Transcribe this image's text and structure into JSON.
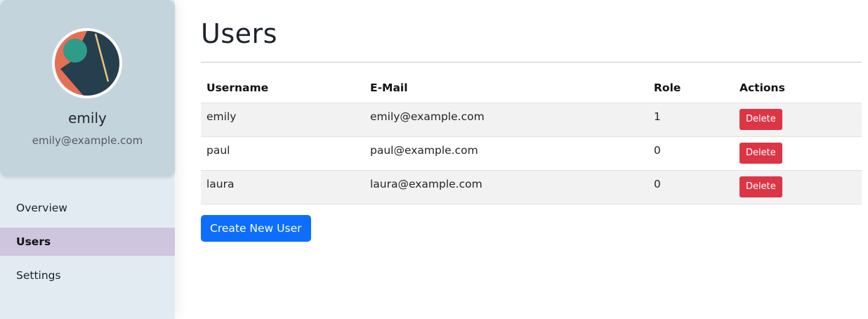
{
  "sidebar": {
    "profile": {
      "name": "emily",
      "email": "emily@example.com",
      "avatar_icon": "abstract-avatar-icon"
    },
    "items": [
      {
        "label": "Overview",
        "active": false
      },
      {
        "label": "Users",
        "active": true
      },
      {
        "label": "Settings",
        "active": false
      }
    ],
    "active_color": "#cfc5de"
  },
  "main": {
    "title": "Users",
    "table": {
      "columns": [
        "Username",
        "E-Mail",
        "Role",
        "Actions"
      ],
      "rows": [
        {
          "username": "emily",
          "email": "emily@example.com",
          "role": "1",
          "action": "Delete"
        },
        {
          "username": "paul",
          "email": "paul@example.com",
          "role": "0",
          "action": "Delete"
        },
        {
          "username": "laura",
          "email": "laura@example.com",
          "role": "0",
          "action": "Delete"
        }
      ]
    },
    "create_button": "Create New User"
  },
  "colors": {
    "primary": "#0d6efd",
    "danger": "#dc3545",
    "sidebar_bg": "#e3ebf2",
    "profile_bg": "#c4d4dc"
  }
}
